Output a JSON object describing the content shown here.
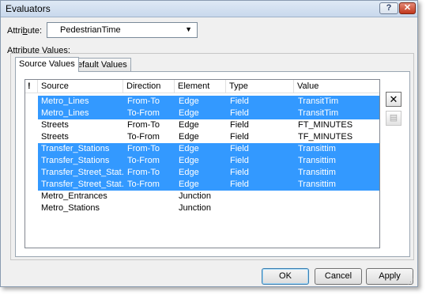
{
  "window": {
    "title": "Evaluators",
    "help_label": "?",
    "close_label": "✕"
  },
  "attribute": {
    "label_prefix": "Attri",
    "label_underlined": "b",
    "label_suffix": "ute:",
    "value": "PedestrianTime"
  },
  "group_label": "Attribute Values:",
  "tabs": [
    {
      "label": "Source Values"
    },
    {
      "label": "Default Values"
    }
  ],
  "table": {
    "headers": [
      "!",
      "Source",
      "Direction",
      "Element",
      "Type",
      "Value"
    ],
    "rows": [
      {
        "source": "Metro_Lines",
        "direction": "From-To",
        "element": "Edge",
        "type": "Field",
        "value": "TransitTim",
        "selected": true
      },
      {
        "source": "Metro_Lines",
        "direction": "To-From",
        "element": "Edge",
        "type": "Field",
        "value": "TransitTim",
        "selected": true
      },
      {
        "source": "Streets",
        "direction": "From-To",
        "element": "Edge",
        "type": "Field",
        "value": "FT_MINUTES",
        "selected": false
      },
      {
        "source": "Streets",
        "direction": "To-From",
        "element": "Edge",
        "type": "Field",
        "value": "TF_MINUTES",
        "selected": false
      },
      {
        "source": "Transfer_Stations",
        "direction": "From-To",
        "element": "Edge",
        "type": "Field",
        "value": "Transittim",
        "selected": true
      },
      {
        "source": "Transfer_Stations",
        "direction": "To-From",
        "element": "Edge",
        "type": "Field",
        "value": "Transittim",
        "selected": true
      },
      {
        "source": "Transfer_Street_Stat...",
        "direction": "From-To",
        "element": "Edge",
        "type": "Field",
        "value": "Transittim",
        "selected": true
      },
      {
        "source": "Transfer_Street_Stat...",
        "direction": "To-From",
        "element": "Edge",
        "type": "Field",
        "value": "Transittim",
        "selected": true
      },
      {
        "source": "Metro_Entrances",
        "direction": "",
        "element": "Junction",
        "type": "",
        "value": "",
        "selected": false
      },
      {
        "source": "Metro_Stations",
        "direction": "",
        "element": "Junction",
        "type": "",
        "value": "",
        "selected": false
      }
    ]
  },
  "side_buttons": {
    "delete_label": "✕",
    "properties_label": "▤"
  },
  "buttons": {
    "ok": "OK",
    "cancel": "Cancel",
    "apply": "Apply"
  },
  "colors": {
    "selection": "#3399ff",
    "window_bg": "#f0f0f0"
  }
}
